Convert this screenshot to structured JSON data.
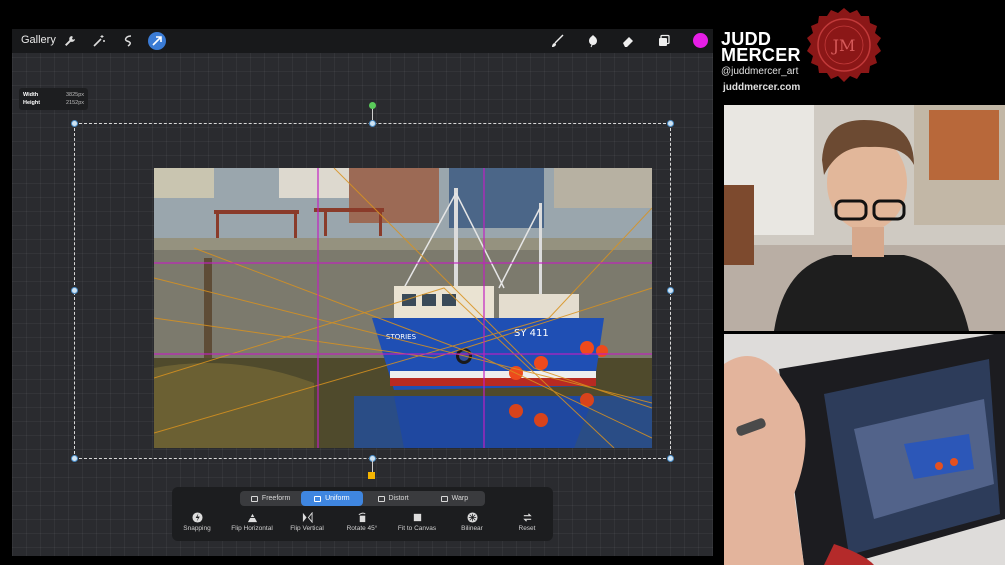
{
  "toolbar": {
    "gallery_label": "Gallery",
    "icons": [
      "wrench-icon",
      "magic-wand-icon",
      "selection-icon",
      "transform-arrow-icon",
      "brush-icon",
      "smudge-icon",
      "eraser-icon",
      "layers-icon"
    ],
    "active_color": "#e61ee6"
  },
  "dimensions": {
    "width_label": "Width",
    "width_value": "3825px",
    "height_label": "Height",
    "height_value": "2152px"
  },
  "transform": {
    "modes": [
      {
        "label": "Freeform",
        "active": false
      },
      {
        "label": "Uniform",
        "active": true
      },
      {
        "label": "Distort",
        "active": false
      },
      {
        "label": "Warp",
        "active": false
      }
    ],
    "actions": [
      {
        "label": "Snapping",
        "icon": "snapping-icon"
      },
      {
        "label": "Flip Horizontal",
        "icon": "flip-horizontal-icon"
      },
      {
        "label": "Flip Vertical",
        "icon": "flip-vertical-icon"
      },
      {
        "label": "Rotate 45°",
        "icon": "rotate-icon"
      },
      {
        "label": "Fit to Canvas",
        "icon": "fit-to-canvas-icon"
      },
      {
        "label": "Bilinear",
        "icon": "bilinear-icon"
      },
      {
        "label": "Reset",
        "icon": "reset-icon"
      }
    ]
  },
  "canvas_photo": {
    "boat_text": "SY 411",
    "boat_name": "STORIES"
  },
  "branding": {
    "name_line1": "JUDD",
    "name_line2": "MERCER",
    "handle": "@juddmercer_art",
    "website": "juddmercer.com",
    "seal_text": "JM"
  },
  "colors": {
    "accent": "#3f86e0",
    "selection": "#4a8cc6",
    "guide": "#c21ec2"
  }
}
